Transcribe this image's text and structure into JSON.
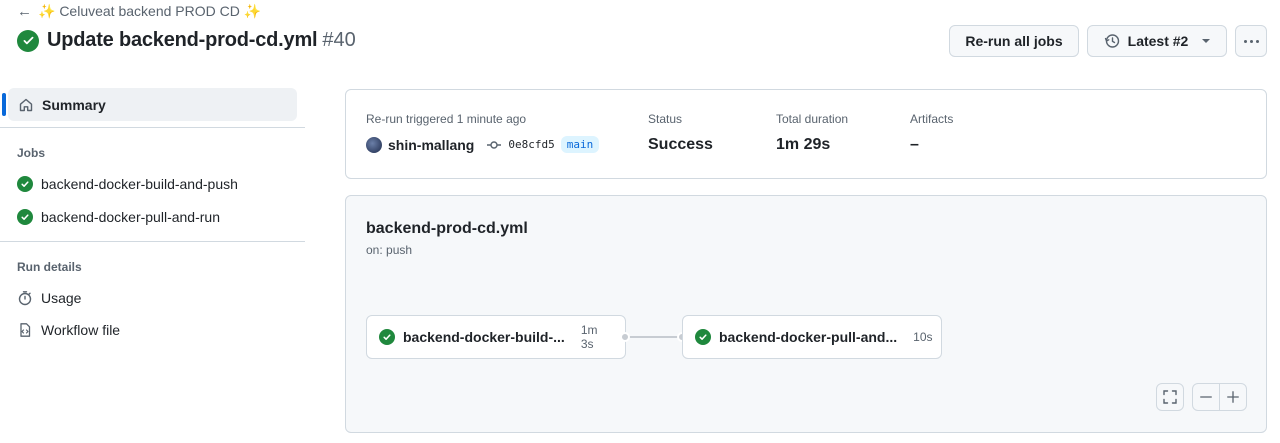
{
  "header": {
    "back_label": "✨ Celuveat backend PROD CD ✨",
    "title": "Update backend-prod-cd.yml",
    "run_number": "#40",
    "rerun_label": "Re-run all jobs",
    "latest_label": "Latest #2"
  },
  "sidebar": {
    "summary_label": "Summary",
    "jobs_heading": "Jobs",
    "jobs": [
      {
        "label": "backend-docker-build-and-push"
      },
      {
        "label": "backend-docker-pull-and-run"
      }
    ],
    "run_details_heading": "Run details",
    "usage_label": "Usage",
    "workflow_file_label": "Workflow file"
  },
  "summary": {
    "trigger_label": "Re-run triggered 1 minute ago",
    "actor": "shin-mallang",
    "commit": "0e8cfd5",
    "branch": "main",
    "status_label": "Status",
    "status_value": "Success",
    "duration_label": "Total duration",
    "duration_value": "1m 29s",
    "artifacts_label": "Artifacts",
    "artifacts_value": "–"
  },
  "workflow": {
    "file": "backend-prod-cd.yml",
    "trigger": "on: push",
    "jobs": [
      {
        "name": "backend-docker-build-...",
        "duration": "1m 3s"
      },
      {
        "name": "backend-docker-pull-and...",
        "duration": "10s"
      }
    ]
  },
  "colors": {
    "success": "#1f883d",
    "accent": "#0969da"
  }
}
